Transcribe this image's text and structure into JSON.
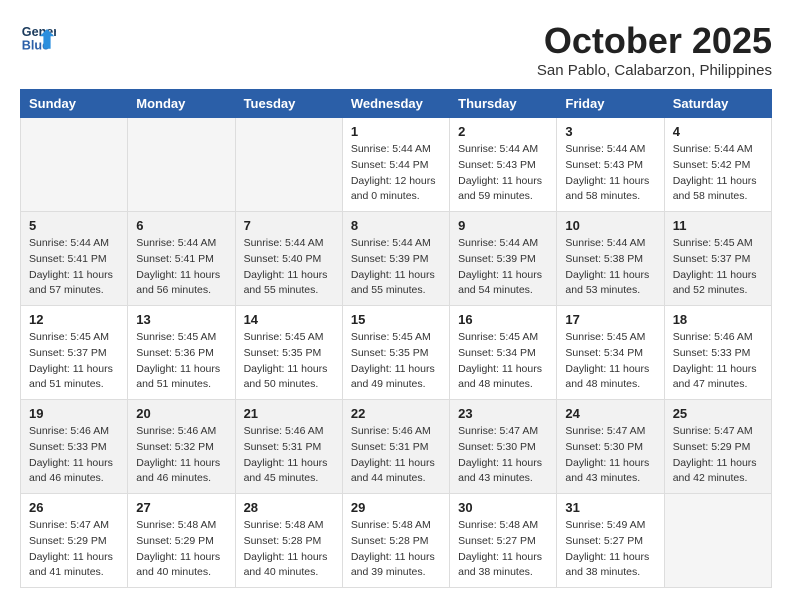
{
  "header": {
    "logo_line1": "General",
    "logo_line2": "Blue",
    "month_title": "October 2025",
    "location": "San Pablo, Calabarzon, Philippines"
  },
  "days_of_week": [
    "Sunday",
    "Monday",
    "Tuesday",
    "Wednesday",
    "Thursday",
    "Friday",
    "Saturday"
  ],
  "weeks": [
    [
      {
        "day": "",
        "info": ""
      },
      {
        "day": "",
        "info": ""
      },
      {
        "day": "",
        "info": ""
      },
      {
        "day": "1",
        "info": "Sunrise: 5:44 AM\nSunset: 5:44 PM\nDaylight: 12 hours\nand 0 minutes."
      },
      {
        "day": "2",
        "info": "Sunrise: 5:44 AM\nSunset: 5:43 PM\nDaylight: 11 hours\nand 59 minutes."
      },
      {
        "day": "3",
        "info": "Sunrise: 5:44 AM\nSunset: 5:43 PM\nDaylight: 11 hours\nand 58 minutes."
      },
      {
        "day": "4",
        "info": "Sunrise: 5:44 AM\nSunset: 5:42 PM\nDaylight: 11 hours\nand 58 minutes."
      }
    ],
    [
      {
        "day": "5",
        "info": "Sunrise: 5:44 AM\nSunset: 5:41 PM\nDaylight: 11 hours\nand 57 minutes."
      },
      {
        "day": "6",
        "info": "Sunrise: 5:44 AM\nSunset: 5:41 PM\nDaylight: 11 hours\nand 56 minutes."
      },
      {
        "day": "7",
        "info": "Sunrise: 5:44 AM\nSunset: 5:40 PM\nDaylight: 11 hours\nand 55 minutes."
      },
      {
        "day": "8",
        "info": "Sunrise: 5:44 AM\nSunset: 5:39 PM\nDaylight: 11 hours\nand 55 minutes."
      },
      {
        "day": "9",
        "info": "Sunrise: 5:44 AM\nSunset: 5:39 PM\nDaylight: 11 hours\nand 54 minutes."
      },
      {
        "day": "10",
        "info": "Sunrise: 5:44 AM\nSunset: 5:38 PM\nDaylight: 11 hours\nand 53 minutes."
      },
      {
        "day": "11",
        "info": "Sunrise: 5:45 AM\nSunset: 5:37 PM\nDaylight: 11 hours\nand 52 minutes."
      }
    ],
    [
      {
        "day": "12",
        "info": "Sunrise: 5:45 AM\nSunset: 5:37 PM\nDaylight: 11 hours\nand 51 minutes."
      },
      {
        "day": "13",
        "info": "Sunrise: 5:45 AM\nSunset: 5:36 PM\nDaylight: 11 hours\nand 51 minutes."
      },
      {
        "day": "14",
        "info": "Sunrise: 5:45 AM\nSunset: 5:35 PM\nDaylight: 11 hours\nand 50 minutes."
      },
      {
        "day": "15",
        "info": "Sunrise: 5:45 AM\nSunset: 5:35 PM\nDaylight: 11 hours\nand 49 minutes."
      },
      {
        "day": "16",
        "info": "Sunrise: 5:45 AM\nSunset: 5:34 PM\nDaylight: 11 hours\nand 48 minutes."
      },
      {
        "day": "17",
        "info": "Sunrise: 5:45 AM\nSunset: 5:34 PM\nDaylight: 11 hours\nand 48 minutes."
      },
      {
        "day": "18",
        "info": "Sunrise: 5:46 AM\nSunset: 5:33 PM\nDaylight: 11 hours\nand 47 minutes."
      }
    ],
    [
      {
        "day": "19",
        "info": "Sunrise: 5:46 AM\nSunset: 5:33 PM\nDaylight: 11 hours\nand 46 minutes."
      },
      {
        "day": "20",
        "info": "Sunrise: 5:46 AM\nSunset: 5:32 PM\nDaylight: 11 hours\nand 46 minutes."
      },
      {
        "day": "21",
        "info": "Sunrise: 5:46 AM\nSunset: 5:31 PM\nDaylight: 11 hours\nand 45 minutes."
      },
      {
        "day": "22",
        "info": "Sunrise: 5:46 AM\nSunset: 5:31 PM\nDaylight: 11 hours\nand 44 minutes."
      },
      {
        "day": "23",
        "info": "Sunrise: 5:47 AM\nSunset: 5:30 PM\nDaylight: 11 hours\nand 43 minutes."
      },
      {
        "day": "24",
        "info": "Sunrise: 5:47 AM\nSunset: 5:30 PM\nDaylight: 11 hours\nand 43 minutes."
      },
      {
        "day": "25",
        "info": "Sunrise: 5:47 AM\nSunset: 5:29 PM\nDaylight: 11 hours\nand 42 minutes."
      }
    ],
    [
      {
        "day": "26",
        "info": "Sunrise: 5:47 AM\nSunset: 5:29 PM\nDaylight: 11 hours\nand 41 minutes."
      },
      {
        "day": "27",
        "info": "Sunrise: 5:48 AM\nSunset: 5:29 PM\nDaylight: 11 hours\nand 40 minutes."
      },
      {
        "day": "28",
        "info": "Sunrise: 5:48 AM\nSunset: 5:28 PM\nDaylight: 11 hours\nand 40 minutes."
      },
      {
        "day": "29",
        "info": "Sunrise: 5:48 AM\nSunset: 5:28 PM\nDaylight: 11 hours\nand 39 minutes."
      },
      {
        "day": "30",
        "info": "Sunrise: 5:48 AM\nSunset: 5:27 PM\nDaylight: 11 hours\nand 38 minutes."
      },
      {
        "day": "31",
        "info": "Sunrise: 5:49 AM\nSunset: 5:27 PM\nDaylight: 11 hours\nand 38 minutes."
      },
      {
        "day": "",
        "info": ""
      }
    ]
  ]
}
